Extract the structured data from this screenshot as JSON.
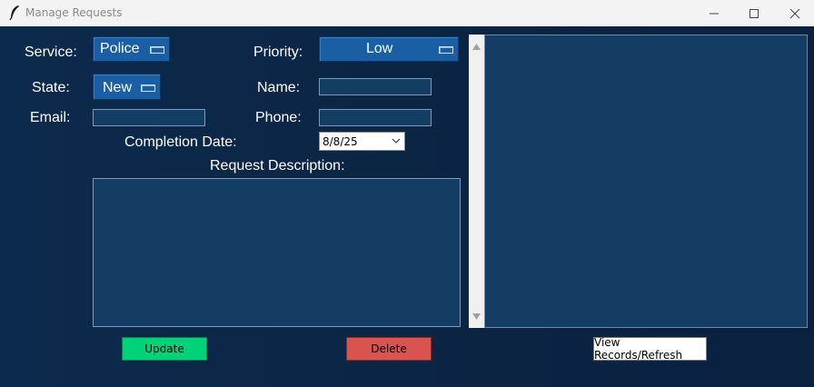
{
  "window": {
    "title": "Manage Requests",
    "controls": [
      "minimize",
      "maximize",
      "close"
    ]
  },
  "form": {
    "service_label": "Service:",
    "service_value": "Police",
    "priority_label": "Priority:",
    "priority_value": "Low",
    "state_label": "State:",
    "state_value": "New",
    "name_label": "Name:",
    "name_value": "",
    "email_label": "Email:",
    "email_value": "",
    "phone_label": "Phone:",
    "phone_value": "",
    "completion_date_label": "Completion Date:",
    "completion_date_value": "8/8/25",
    "description_label": "Request Description:",
    "description_value": ""
  },
  "buttons": {
    "update": "Update",
    "delete": "Delete",
    "view_refresh": "View Records/Refresh"
  },
  "colors": {
    "background": "#0c2a4d",
    "field": "#143d64",
    "menubutton": "#1a5fa3",
    "update": "#00d27a",
    "delete": "#d9534f"
  },
  "records": []
}
